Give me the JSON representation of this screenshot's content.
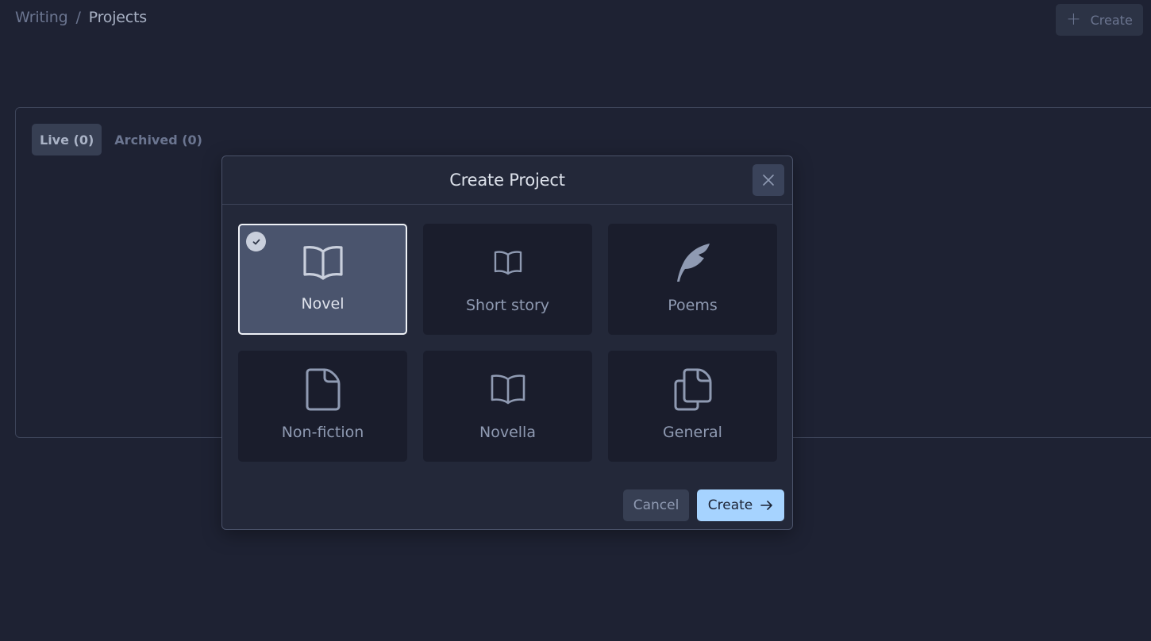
{
  "header": {
    "breadcrumb": {
      "root": "Writing",
      "separator": "/",
      "current": "Projects"
    },
    "create_button": {
      "icon": "plus-icon",
      "label": "Create"
    }
  },
  "panel": {
    "tabs": [
      {
        "label": "Live (0)",
        "active": true
      },
      {
        "label": "Archived (0)",
        "active": false
      }
    ]
  },
  "modal": {
    "title": "Create Project",
    "close_icon": "close-icon",
    "project_types": [
      {
        "label": "Novel",
        "icon": "book-open-icon",
        "selected": true
      },
      {
        "label": "Short story",
        "icon": "book-open-small-icon",
        "selected": false
      },
      {
        "label": "Poems",
        "icon": "feather-icon",
        "selected": false
      },
      {
        "label": "Non-fiction",
        "icon": "document-icon",
        "selected": false
      },
      {
        "label": "Novella",
        "icon": "book-open-icon",
        "selected": false
      },
      {
        "label": "General",
        "icon": "documents-icon",
        "selected": false
      }
    ],
    "cancel_label": "Cancel",
    "create_label": "Create",
    "create_icon": "arrow-right-icon"
  },
  "colors": {
    "background": "#1e2233",
    "modal_bg": "#232839",
    "card_bg": "#1a1d2c",
    "selected_card_bg": "#4a546d",
    "primary_button": "#a6d3ff"
  }
}
